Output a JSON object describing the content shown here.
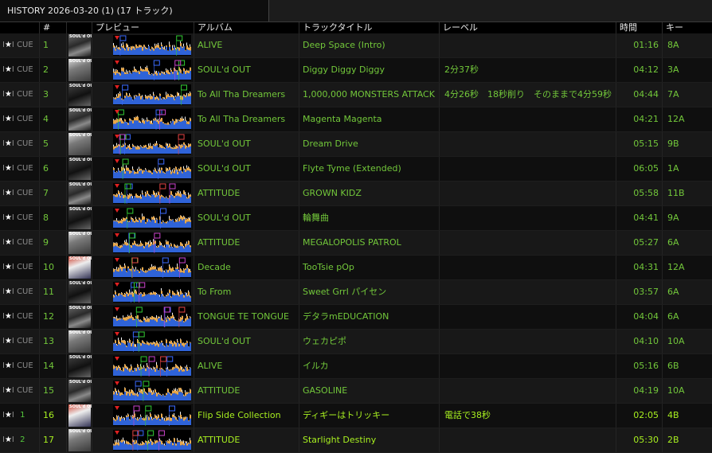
{
  "tab": {
    "title": "HISTORY 2026-03-20 (1) (17 トラック)"
  },
  "columns": {
    "num": "#",
    "preview": "プレビュー",
    "album": "アルバム",
    "title": "トラックタイトル",
    "label": "レーベル",
    "time": "時間",
    "key": "キー"
  },
  "cue_label": "CUE",
  "artwork_text": "SOUL'd OUT",
  "colors": {
    "text": "#72c73a",
    "played": "#a8f020",
    "row_odd": "#181818",
    "row_even": "#0f0f0f"
  },
  "tracks": [
    {
      "num": "1",
      "album": "ALIVE",
      "title": "Deep Space (Intro)",
      "label": "",
      "time": "01:16",
      "key": "8A",
      "cue": "CUE",
      "played": false
    },
    {
      "num": "2",
      "album": "SOUL'd OUT",
      "title": "Diggy Diggy Diggy",
      "label": "2分37秒",
      "time": "04:12",
      "key": "3A",
      "cue": "CUE",
      "played": false
    },
    {
      "num": "3",
      "album": "To All Tha Dreamers",
      "title": "1,000,000 MONSTERS ATTACK",
      "label": "4分26秒　18秒削り　そのままで4分59秒",
      "time": "04:44",
      "key": "7A",
      "cue": "CUE",
      "played": false
    },
    {
      "num": "4",
      "album": "To All Tha Dreamers",
      "title": "Magenta Magenta",
      "label": "",
      "time": "04:21",
      "key": "12A",
      "cue": "CUE",
      "played": false
    },
    {
      "num": "5",
      "album": "SOUL'd OUT",
      "title": "Dream Drive",
      "label": "",
      "time": "05:15",
      "key": "9B",
      "cue": "CUE",
      "played": false
    },
    {
      "num": "6",
      "album": "SOUL'd OUT",
      "title": "Flyte Tyme (Extended)",
      "label": "",
      "time": "06:05",
      "key": "1A",
      "cue": "CUE",
      "played": false
    },
    {
      "num": "7",
      "album": "ATTITUDE",
      "title": "GROWN KIDZ",
      "label": "",
      "time": "05:58",
      "key": "11B",
      "cue": "CUE",
      "played": false
    },
    {
      "num": "8",
      "album": "SOUL'd OUT",
      "title": "輪舞曲",
      "label": "",
      "time": "04:41",
      "key": "9A",
      "cue": "CUE",
      "played": false
    },
    {
      "num": "9",
      "album": "ATTITUDE",
      "title": "MEGALOPOLIS PATROL",
      "label": "",
      "time": "05:27",
      "key": "6A",
      "cue": "CUE",
      "played": false
    },
    {
      "num": "10",
      "album": "Decade",
      "title": "TooTsie pOp",
      "label": "",
      "time": "04:31",
      "key": "12A",
      "cue": "CUE",
      "played": false
    },
    {
      "num": "11",
      "album": "To From",
      "title": "Sweet Grrl パイセン",
      "label": "",
      "time": "03:57",
      "key": "6A",
      "cue": "CUE",
      "played": false
    },
    {
      "num": "12",
      "album": "TONGUE TE TONGUE",
      "title": "デタラmEDUCATION",
      "label": "",
      "time": "04:04",
      "key": "6A",
      "cue": "CUE",
      "played": false
    },
    {
      "num": "13",
      "album": "SOUL'd OUT",
      "title": "ウェカピポ",
      "label": "",
      "time": "04:10",
      "key": "10A",
      "cue": "CUE",
      "played": false
    },
    {
      "num": "14",
      "album": "ALIVE",
      "title": "イルカ",
      "label": "",
      "time": "05:16",
      "key": "6B",
      "cue": "CUE",
      "played": false
    },
    {
      "num": "15",
      "album": "ATTITUDE",
      "title": "GASOLINE",
      "label": "",
      "time": "04:19",
      "key": "10A",
      "cue": "CUE",
      "played": false
    },
    {
      "num": "16",
      "album": "Flip Side Collection",
      "title": "ディギーはトリッキー",
      "label": "電話で38秒",
      "time": "02:05",
      "key": "4B",
      "cue": "1",
      "played": true
    },
    {
      "num": "17",
      "album": "ATTITUDE",
      "title": "Starlight Destiny",
      "label": "",
      "time": "05:30",
      "key": "2B",
      "cue": "2",
      "played": true
    }
  ]
}
